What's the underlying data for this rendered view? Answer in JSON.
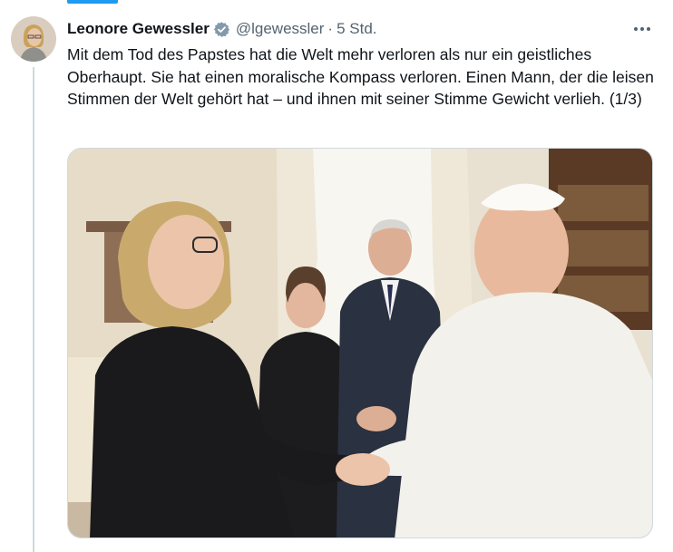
{
  "tweet": {
    "author_name": "Leonore Gewessler",
    "handle": "@lgewessler",
    "separator": "·",
    "time": "5 Std.",
    "text": "Mit dem Tod des Papstes hat die Welt mehr verloren als nur ein geistliches Oberhaupt. Sie hat einen moralische Kompass verloren. Einen Mann, der die leisen Stimmen der Welt gehört hat – und ihnen mit seiner Stimme Gewicht verlieh. (1/3)"
  },
  "icons": {
    "verified": "verified-badge-icon",
    "more": "more-options-icon"
  },
  "colors": {
    "accent": "#1d9bf0",
    "secondary_text": "#536471",
    "primary_text": "#0f1419"
  }
}
